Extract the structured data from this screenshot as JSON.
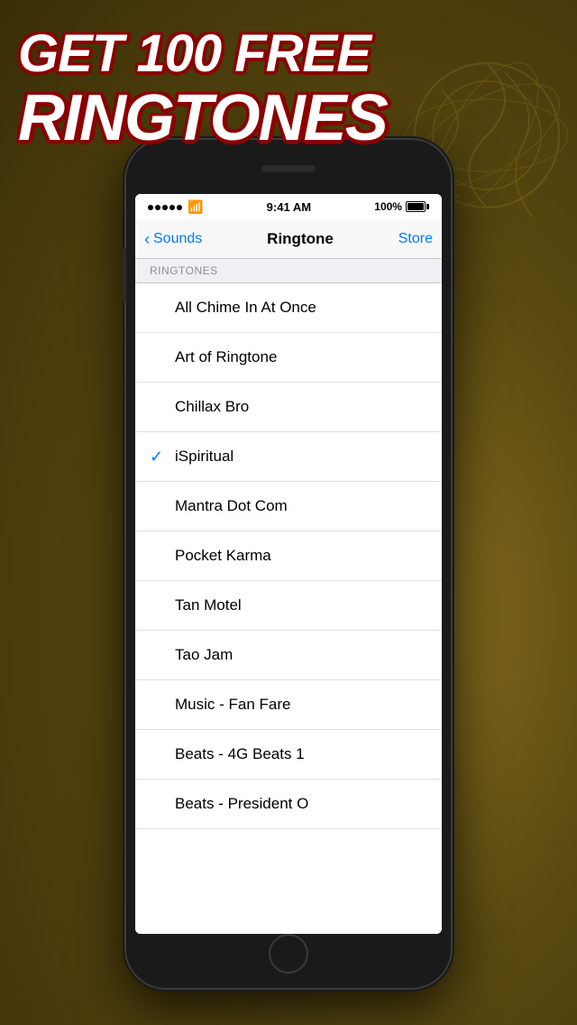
{
  "background": {
    "color": "#5a4a10"
  },
  "promo": {
    "line1": "GET 100 FREE",
    "line2": "RINGTONES"
  },
  "status_bar": {
    "signal_dots": 5,
    "time": "9:41 AM",
    "battery": "100%"
  },
  "nav": {
    "back_label": "Sounds",
    "title": "Ringtone",
    "store_label": "Store"
  },
  "section": {
    "header": "RINGTONES"
  },
  "ringtones": [
    {
      "name": "All Chime In At Once",
      "selected": false
    },
    {
      "name": "Art of Ringtone",
      "selected": false
    },
    {
      "name": "Chillax Bro",
      "selected": false
    },
    {
      "name": "iSpiritual",
      "selected": true
    },
    {
      "name": "Mantra Dot Com",
      "selected": false
    },
    {
      "name": "Pocket Karma",
      "selected": false
    },
    {
      "name": "Tan Motel",
      "selected": false
    },
    {
      "name": "Tao Jam",
      "selected": false
    },
    {
      "name": "Music - Fan Fare",
      "selected": false
    },
    {
      "name": "Beats - 4G Beats 1",
      "selected": false
    },
    {
      "name": "Beats - President O",
      "selected": false
    }
  ]
}
